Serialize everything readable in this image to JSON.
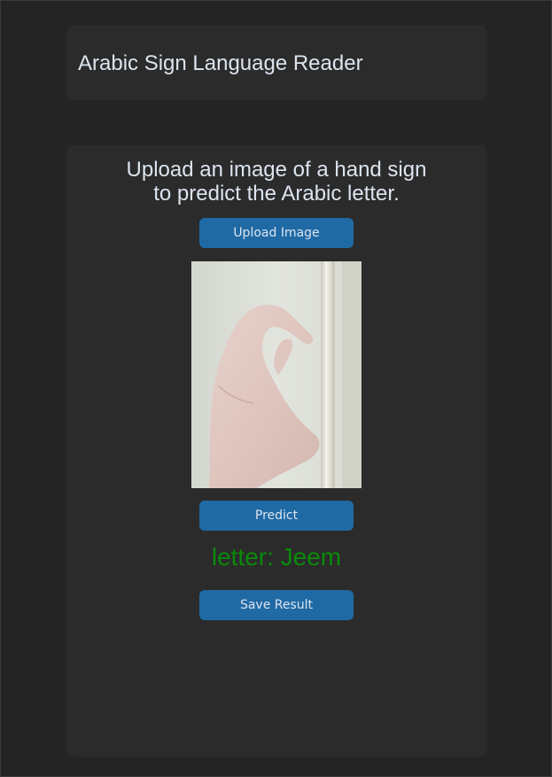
{
  "header": {
    "title": "Arabic Sign Language Reader"
  },
  "main": {
    "instruction_line1": "Upload an image of a hand sign",
    "instruction_line2": "to predict the Arabic letter.",
    "upload_label": "Upload Image",
    "predict_label": "Predict",
    "prediction_text": "letter: Jeem",
    "save_label": "Save Result"
  },
  "colors": {
    "background": "#242424",
    "panel": "#2b2b2b",
    "button": "#1f6aa5",
    "text": "#dce4ee",
    "prediction": "#0a8a0a"
  }
}
